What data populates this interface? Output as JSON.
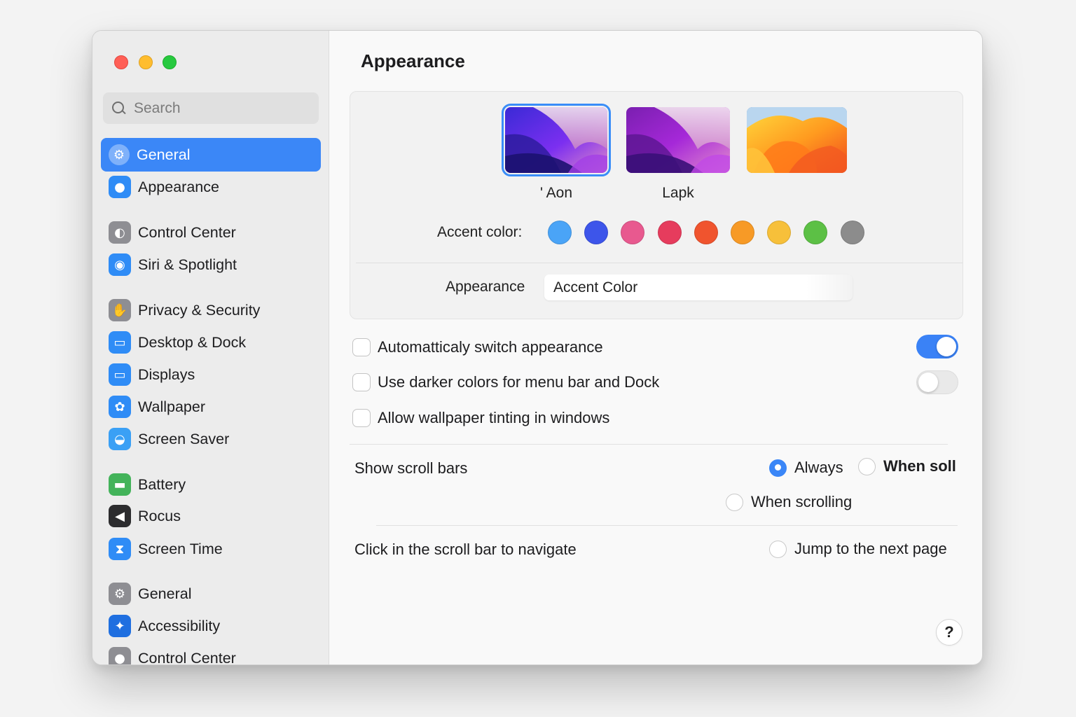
{
  "window": {
    "traffic_lights": [
      "close",
      "minimize",
      "zoom"
    ]
  },
  "sidebar": {
    "search_placeholder": "Search",
    "items": [
      {
        "label": "General",
        "icon": "gear-icon",
        "selected": true,
        "color": "#8e8e93"
      },
      {
        "label": "Appearance",
        "icon": "appearance-icon",
        "selected": false,
        "color": "#2f8cf6"
      },
      {
        "label": "Control Center",
        "icon": "control-center-icon",
        "selected": false,
        "color": "#8e8e93"
      },
      {
        "label": "Siri & Spotlight",
        "icon": "siri-icon",
        "selected": false,
        "color": "#2f8cf6"
      },
      {
        "label": "Privacy & Security",
        "icon": "hand-icon",
        "selected": false,
        "color": "#8e8e93"
      },
      {
        "label": "Desktop & Dock",
        "icon": "dock-icon",
        "selected": false,
        "color": "#2f8cf6"
      },
      {
        "label": "Displays",
        "icon": "display-icon",
        "selected": false,
        "color": "#2f8cf6"
      },
      {
        "label": "Wallpaper",
        "icon": "wallpaper-icon",
        "selected": false,
        "color": "#2f8cf6"
      },
      {
        "label": "Screen Saver",
        "icon": "screen-saver-icon",
        "selected": false,
        "color": "#3aa0f5"
      },
      {
        "label": "Battery",
        "icon": "battery-icon",
        "selected": false,
        "color": "#43b35a"
      },
      {
        "label": "Rocus",
        "icon": "speaker-icon",
        "selected": false,
        "color": "#2c2c2e"
      },
      {
        "label": "Screen Time",
        "icon": "hourglass-icon",
        "selected": false,
        "color": "#2f8cf6"
      },
      {
        "label": "General",
        "icon": "gear-icon",
        "selected": false,
        "color": "#8e8e93"
      },
      {
        "label": "Accessibility",
        "icon": "accessibility-icon",
        "selected": false,
        "color": "#1f6fe0"
      },
      {
        "label": "Control Center",
        "icon": "person-icon",
        "selected": false,
        "color": "#8e8e93"
      }
    ]
  },
  "main": {
    "title": "Appearance",
    "themes": [
      {
        "label": "' Aon",
        "selected": true
      },
      {
        "label": "Lapk",
        "selected": false
      },
      {
        "label": "",
        "selected": false
      }
    ],
    "accent_label": "Accent color:",
    "accent_colors": [
      "#4aa4f7",
      "#3d55ea",
      "#e8598f",
      "#e63c5d",
      "#f0542e",
      "#f79a26",
      "#f7c03a",
      "#5cc045",
      "#8c8c8c"
    ],
    "appearance_label": "Appearance",
    "appearance_value": "Accent Color",
    "options": [
      {
        "label": "Automatticaly  switch appearance",
        "checked": false,
        "toggle": true
      },
      {
        "label": "Use darker colors for menu bar  and Dock",
        "checked": false,
        "toggle": false
      },
      {
        "label": "Allow wallpaper tinting in windows",
        "checked": false
      }
    ],
    "scroll_bars": {
      "label": "Show scroll bars",
      "options": [
        {
          "label": "Always",
          "selected": true,
          "bold": false
        },
        {
          "label": "When soll",
          "selected": false,
          "bold": true
        },
        {
          "label": "When scrolling",
          "selected": false,
          "bold": false
        }
      ]
    },
    "click_scroll": {
      "label": "Click in the scroll bar to navigate",
      "option": {
        "label": "Jump to the next page",
        "selected": false
      }
    },
    "help": "?"
  }
}
